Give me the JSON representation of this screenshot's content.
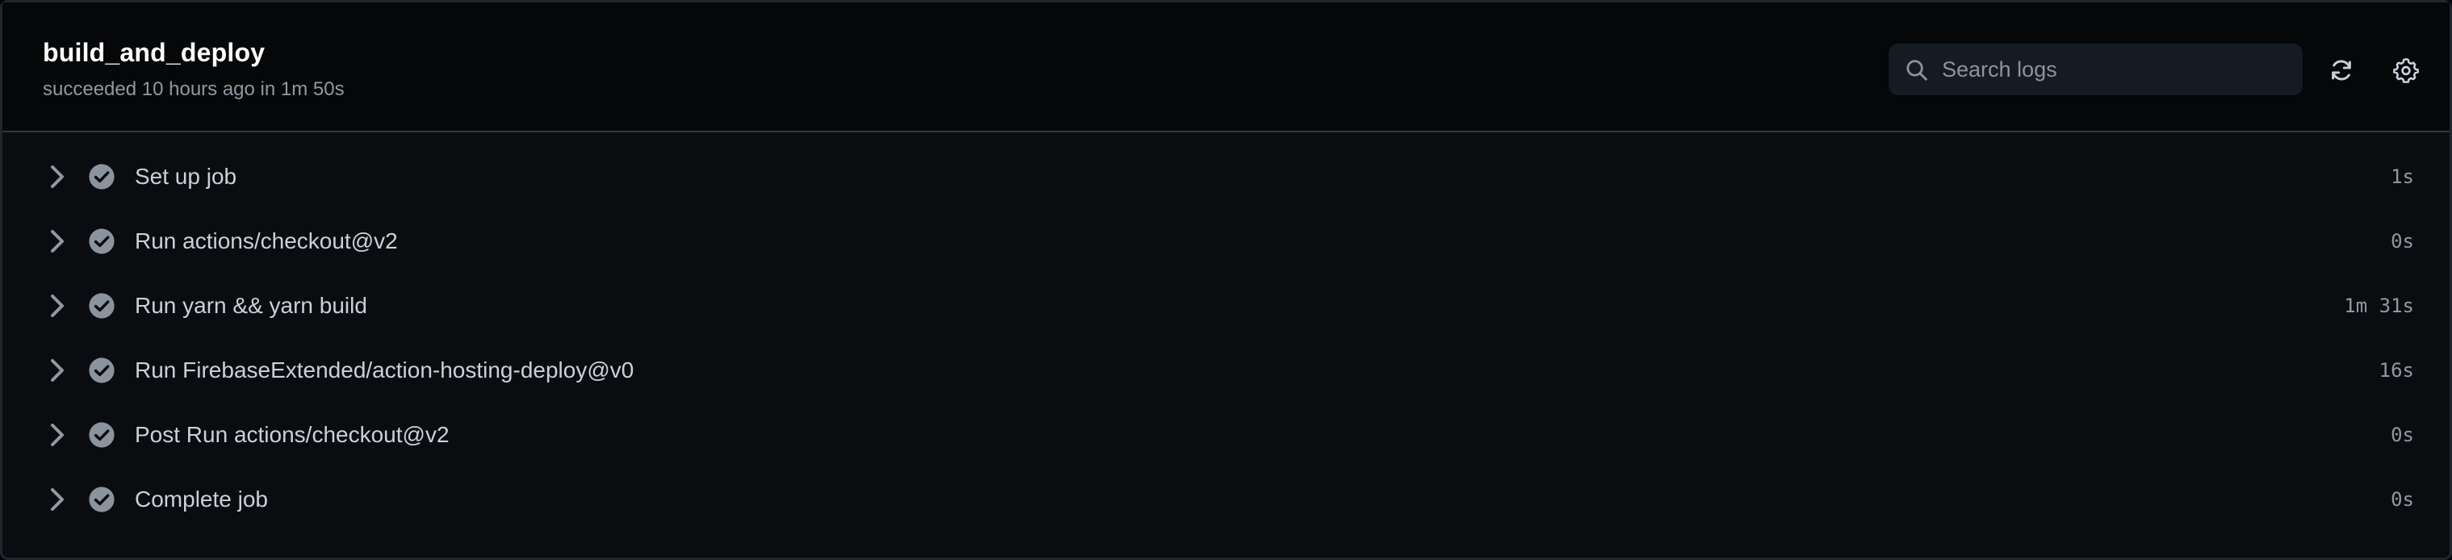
{
  "job": {
    "title": "build_and_deploy",
    "status": "succeeded 10 hours ago in 1m 50s"
  },
  "search": {
    "placeholder": "Search logs",
    "value": ""
  },
  "toolbar": {
    "refresh_icon": "sync-icon",
    "settings_icon": "gear-icon"
  },
  "steps": [
    {
      "name": "Set up job",
      "duration": "1s",
      "status": "success"
    },
    {
      "name": "Run actions/checkout@v2",
      "duration": "0s",
      "status": "success"
    },
    {
      "name": "Run yarn && yarn build",
      "duration": "1m 31s",
      "status": "success"
    },
    {
      "name": "Run FirebaseExtended/action-hosting-deploy@v0",
      "duration": "16s",
      "status": "success"
    },
    {
      "name": "Post Run actions/checkout@v2",
      "duration": "0s",
      "status": "success"
    },
    {
      "name": "Complete job",
      "duration": "0s",
      "status": "success"
    }
  ],
  "colors": {
    "background": "#0a0c10",
    "success_check": "#8b949e",
    "text": "#c9d1d9",
    "muted": "#9198a1"
  }
}
